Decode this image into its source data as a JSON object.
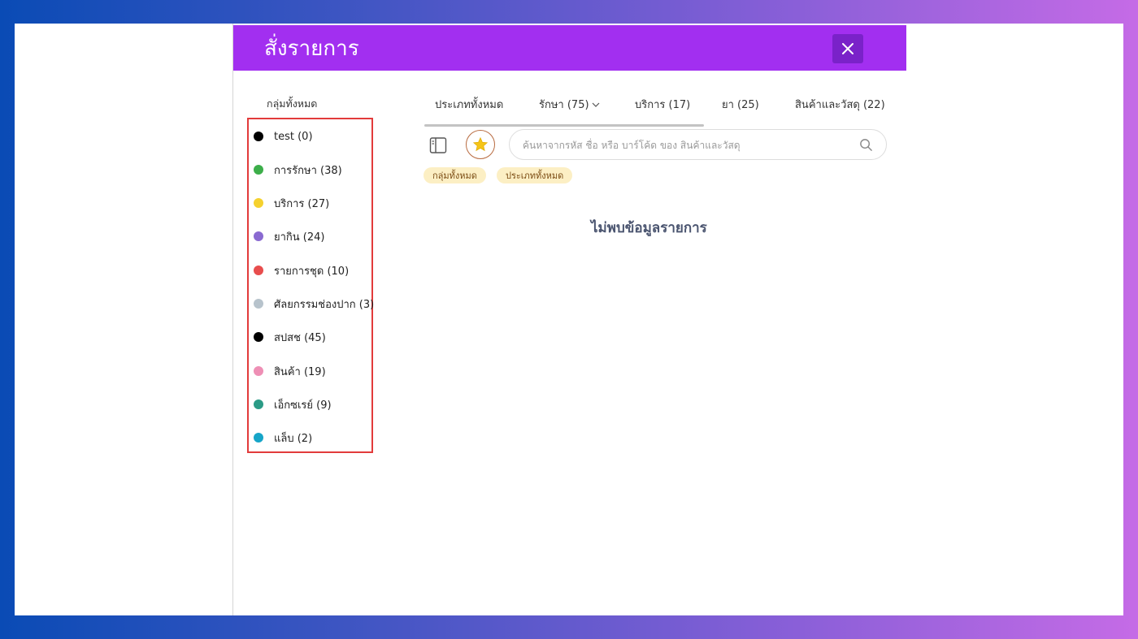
{
  "header": {
    "title": "สั่งรายการ",
    "close_label": "✕"
  },
  "sidebar": {
    "heading": "กลุ่มทั้งหมด",
    "groups": [
      {
        "label": "test (0)",
        "color": "#000000"
      },
      {
        "label": "การรักษา (38)",
        "color": "#3cae4a"
      },
      {
        "label": "บริการ (27)",
        "color": "#f5d12e"
      },
      {
        "label": "ยากิน (24)",
        "color": "#8a6ad1"
      },
      {
        "label": "รายการชุด (10)",
        "color": "#e84d4d"
      },
      {
        "label": "ศัลยกรรมช่องปาก (3)",
        "color": "#b7c3cc"
      },
      {
        "label": "สปสช (45)",
        "color": "#000000"
      },
      {
        "label": "สินค้า (19)",
        "color": "#ee8fb5"
      },
      {
        "label": "เอ็กซเรย์ (9)",
        "color": "#2b9b86"
      },
      {
        "label": "แล็บ (2)",
        "color": "#16a5c8"
      }
    ]
  },
  "tabs": [
    {
      "label": "ประเภททั้งหมด"
    },
    {
      "label": "รักษา (75)",
      "has_dropdown": true
    },
    {
      "label": "บริการ (17)"
    },
    {
      "label": "ยา (25)"
    },
    {
      "label": "สินค้าและวัสดุ (22)"
    }
  ],
  "search": {
    "placeholder": "ค้นหาจากรหัส ชื่อ หรือ บาร์โค้ด ของ สินค้าและวัสดุ",
    "value": ""
  },
  "filters": [
    "กลุ่มทั้งหมด",
    "ประเภททั้งหมด"
  ],
  "main": {
    "empty_message": "ไม่พบข้อมูลรายการ"
  },
  "colors": {
    "header": "#a22ff0",
    "close_button": "#7a22c9",
    "highlight_border": "#e23b3b",
    "chip_bg": "#fcefc4",
    "favorite_star": "#f5c518"
  },
  "icons": {
    "close": "close-icon",
    "sidebar_toggle": "sidebar-toggle-icon",
    "favorite": "star-icon",
    "search": "search-icon",
    "dropdown": "chevron-down-icon"
  }
}
